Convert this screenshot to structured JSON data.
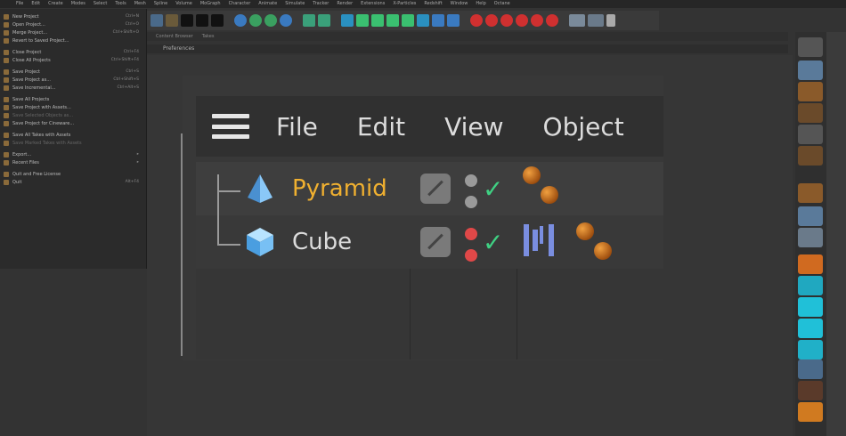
{
  "top_menu": [
    "File",
    "Edit",
    "Create",
    "Modes",
    "Select",
    "Tools",
    "Mesh",
    "Spline",
    "Volume",
    "MoGraph",
    "Character",
    "Animate",
    "Simulate",
    "Tracker",
    "Render",
    "Extensions",
    "X-Particles",
    "Redshift",
    "Window",
    "Help",
    "Octane"
  ],
  "file_menu": [
    {
      "label": "New Project",
      "shortcut": "Ctrl+N"
    },
    {
      "label": "Open Project...",
      "shortcut": "Ctrl+O"
    },
    {
      "label": "Merge Project...",
      "shortcut": "Ctrl+Shift+O"
    },
    {
      "label": "Revert to Saved Project...",
      "shortcut": ""
    },
    {
      "sep": true
    },
    {
      "label": "Close Project",
      "shortcut": "Ctrl+F4"
    },
    {
      "label": "Close All Projects",
      "shortcut": "Ctrl+Shift+F4"
    },
    {
      "sep": true
    },
    {
      "label": "Save Project",
      "shortcut": "Ctrl+S"
    },
    {
      "label": "Save Project as...",
      "shortcut": "Ctrl+Shift+S"
    },
    {
      "label": "Save Incremental...",
      "shortcut": "Ctrl+Alt+S"
    },
    {
      "sep": true
    },
    {
      "label": "Save All Projects",
      "shortcut": ""
    },
    {
      "label": "Save Project with Assets...",
      "shortcut": ""
    },
    {
      "label": "Save Selected Objects as...",
      "shortcut": "",
      "disabled": true
    },
    {
      "label": "Save Project for Cineware...",
      "shortcut": ""
    },
    {
      "sep": true
    },
    {
      "label": "Save All Takes with Assets",
      "shortcut": ""
    },
    {
      "label": "Save Marked Takes with Assets",
      "shortcut": "",
      "disabled": true
    },
    {
      "sep": true
    },
    {
      "label": "Export...",
      "shortcut": "▸"
    },
    {
      "label": "Recent Files",
      "shortcut": "▸"
    },
    {
      "sep": true
    },
    {
      "label": "Quit and Free License",
      "shortcut": ""
    },
    {
      "label": "Quit",
      "shortcut": "Alt+F4"
    }
  ],
  "subtabs": [
    "Content Browser",
    "Takes"
  ],
  "panel_title": "Preferences",
  "objmgr": {
    "menu": {
      "file": "File",
      "edit": "Edit",
      "view": "View",
      "object": "Object"
    },
    "objects": [
      {
        "name": "Pyramid",
        "name_color": "#f0b030",
        "selected": true,
        "dot_color": "#9a9a9a"
      },
      {
        "name": "Cube",
        "name_color": "#dcdcdc",
        "selected": false,
        "dot_color": "#e04848"
      }
    ]
  },
  "colors": {
    "accent_orange": "#f0b030",
    "check_green": "#3fd183",
    "icon_blue": "#6ab8f0"
  }
}
